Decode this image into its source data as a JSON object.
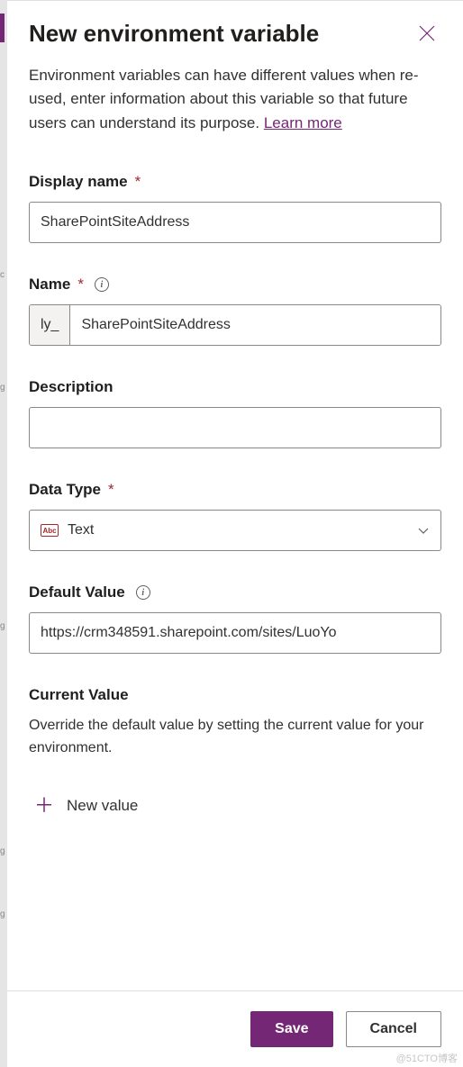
{
  "header": {
    "title": "New environment variable"
  },
  "intro": {
    "text": "Environment variables can have different values when re-used, enter information about this variable so that future users can understand its purpose. ",
    "link_label": "Learn more"
  },
  "fields": {
    "display_name": {
      "label": "Display name",
      "value": "SharePointSiteAddress"
    },
    "name": {
      "label": "Name",
      "prefix": "ly_",
      "value": "SharePointSiteAddress"
    },
    "description": {
      "label": "Description",
      "value": ""
    },
    "data_type": {
      "label": "Data Type",
      "selected": "Text",
      "icon_text": "Abc"
    },
    "default_value": {
      "label": "Default Value",
      "value": "https://crm348591.sharepoint.com/sites/LuoYo"
    },
    "current_value": {
      "label": "Current Value",
      "description": "Override the default value by setting the current value for your environment.",
      "new_value_label": "New value"
    }
  },
  "footer": {
    "save_label": "Save",
    "cancel_label": "Cancel"
  },
  "watermark": "@51CTO博客"
}
